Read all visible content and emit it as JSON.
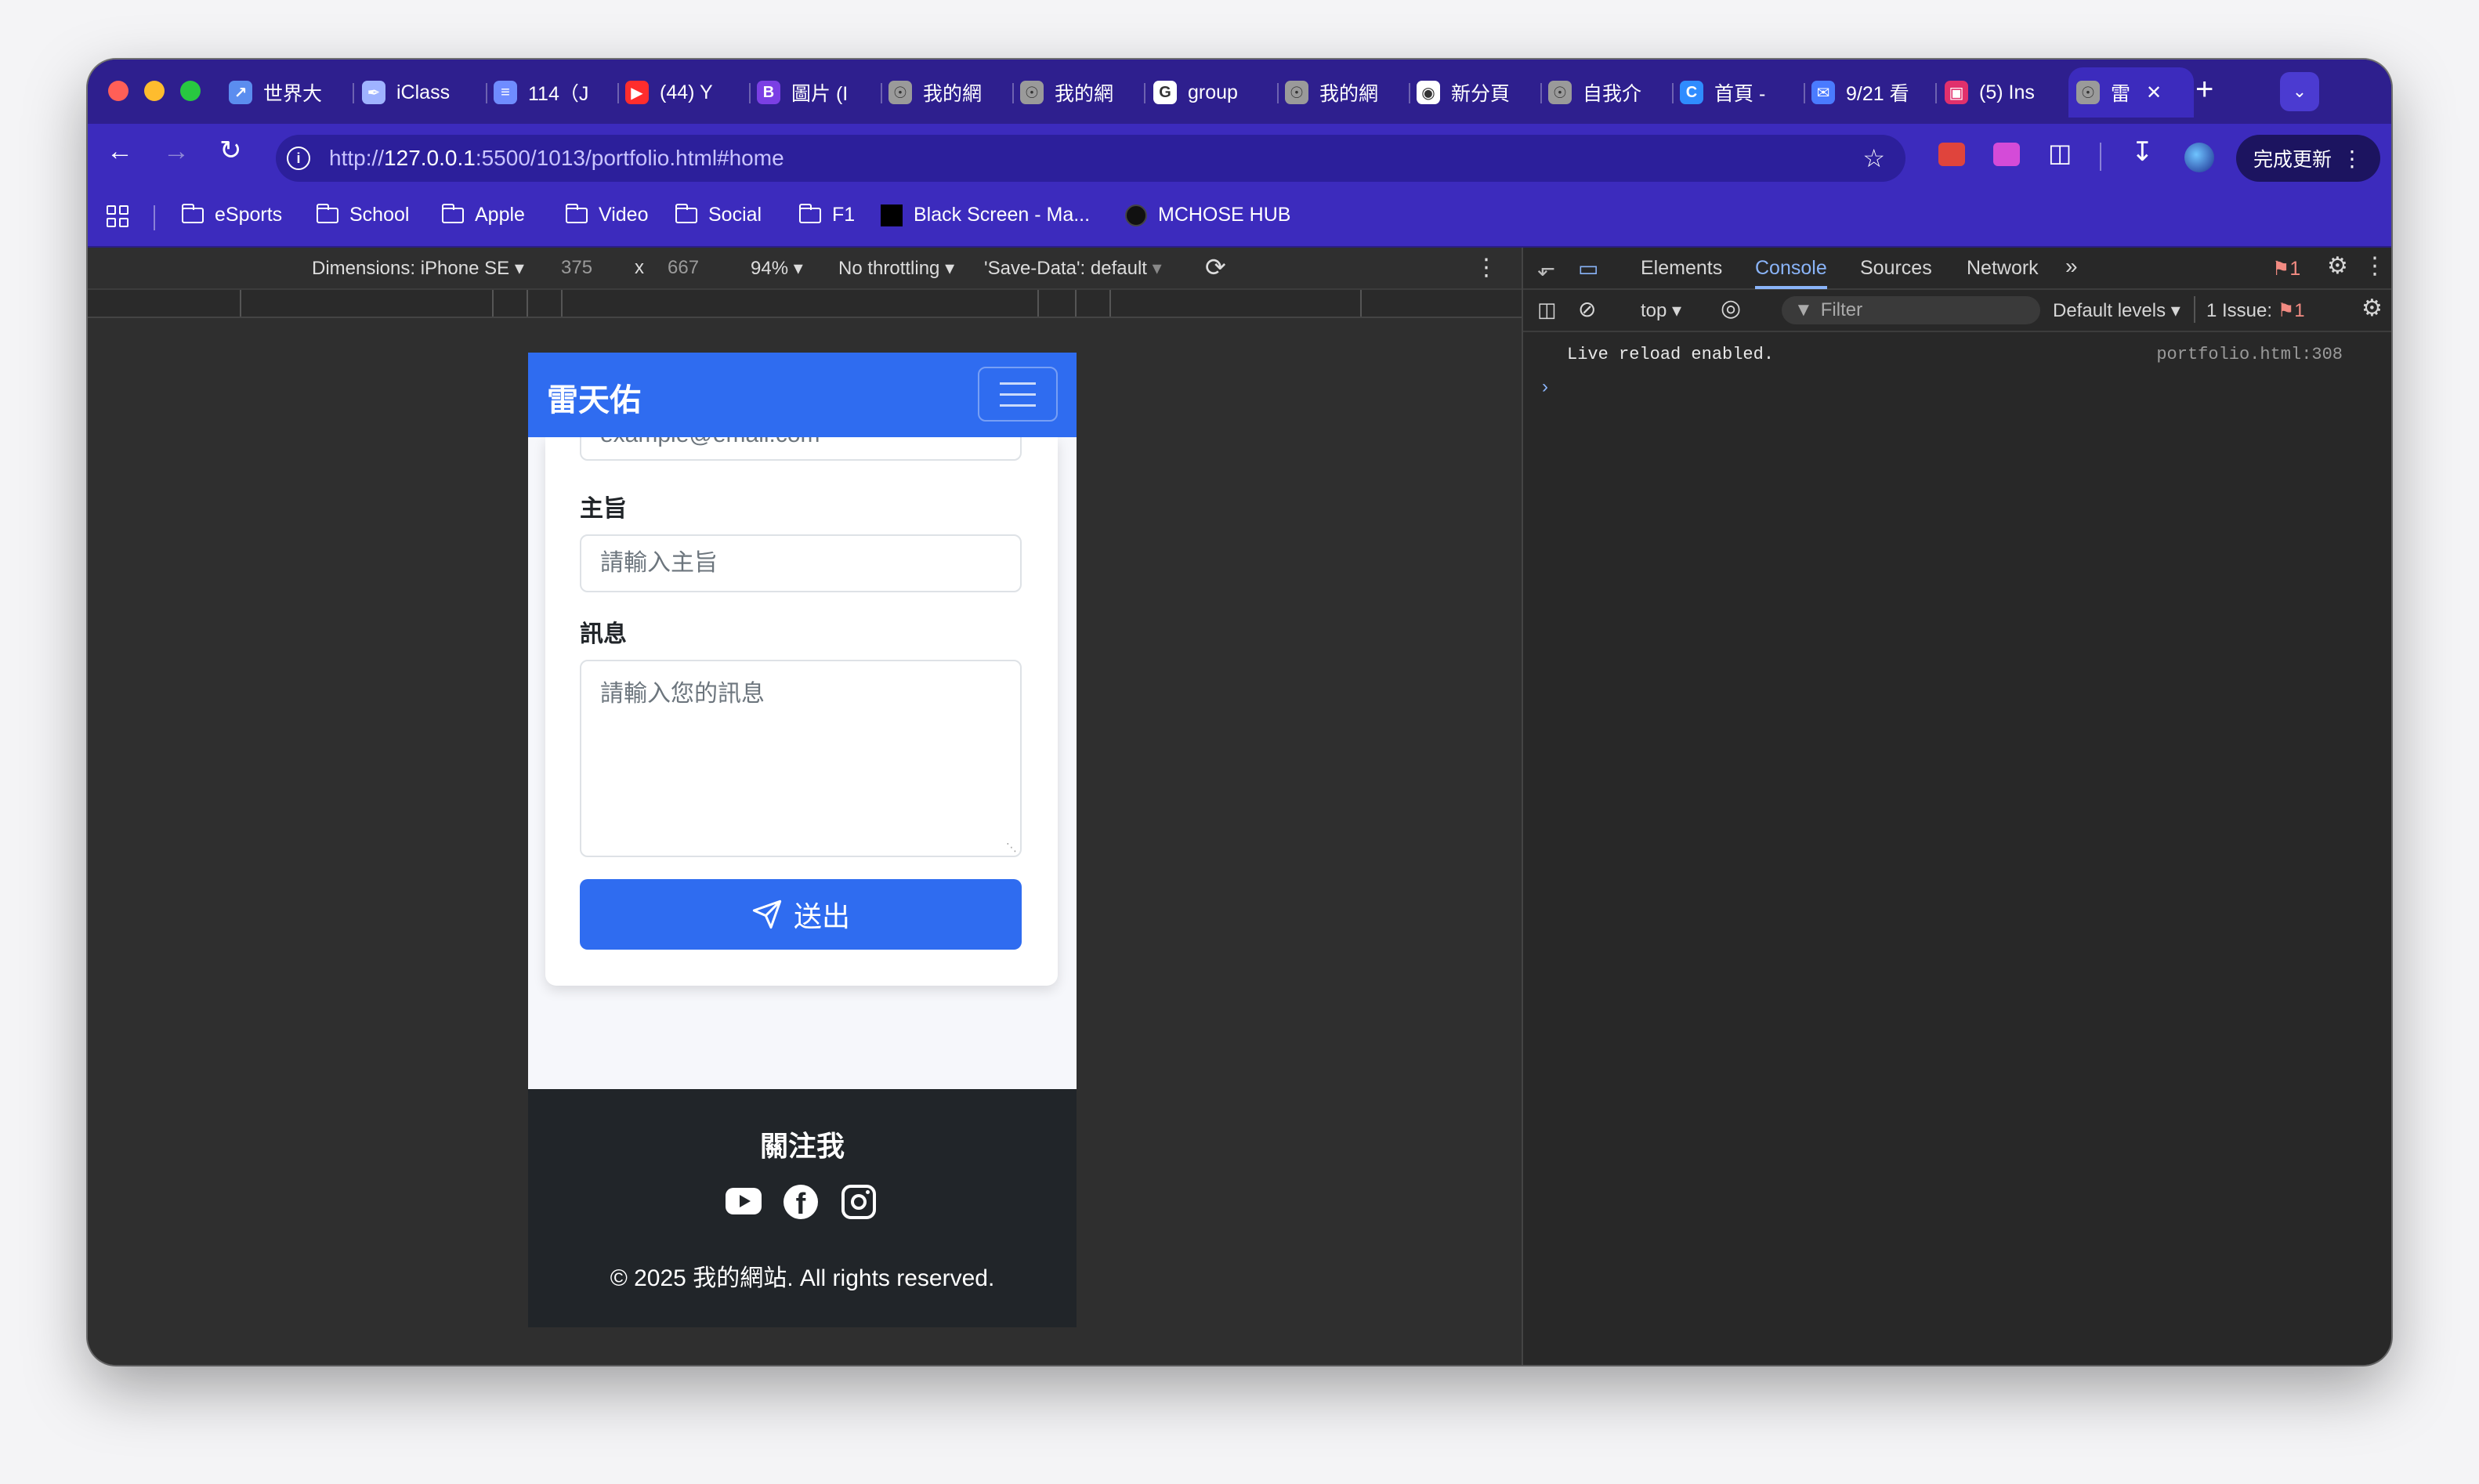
{
  "browser": {
    "tabs": [
      {
        "label": "世界大",
        "icon": "link-icon",
        "color": "#5b8def"
      },
      {
        "label": "iClass",
        "icon": "feather-icon",
        "color": "#9fb3ff"
      },
      {
        "label": "114（J",
        "icon": "layers-icon",
        "color": "#6f8cff"
      },
      {
        "label": "(44) Y",
        "icon": "youtube-icon",
        "color": "#ff2d2d"
      },
      {
        "label": "圖片 (I",
        "icon": "b-icon",
        "color": "#7b3fe4"
      },
      {
        "label": "我的網",
        "icon": "globe-icon",
        "color": "#9a9a9a"
      },
      {
        "label": "我的網",
        "icon": "globe-icon",
        "color": "#9a9a9a"
      },
      {
        "label": "group",
        "icon": "google-icon",
        "color": "#ffffff"
      },
      {
        "label": "我的網",
        "icon": "globe-icon",
        "color": "#9a9a9a"
      },
      {
        "label": "新分頁",
        "icon": "chrome-icon",
        "color": "#ffffff"
      },
      {
        "label": "自我介",
        "icon": "globe-icon",
        "color": "#9a9a9a"
      },
      {
        "label": "首頁 -",
        "icon": "c-icon",
        "color": "#2f8cff"
      },
      {
        "label": "9/21 看",
        "icon": "chat-icon",
        "color": "#4a7bff"
      },
      {
        "label": "(5) Ins",
        "icon": "instagram-icon",
        "color": "#e1306c"
      },
      {
        "label": "雷",
        "icon": "globe-icon",
        "color": "#9a9a9a"
      }
    ],
    "url_prefix": "http://",
    "url_host": "127.0.0.1",
    "url_rest": ":5500/1013/portfolio.html#home",
    "update_label": "完成更新",
    "bookmarks": [
      {
        "label": "eSports",
        "icon": "folder-icon"
      },
      {
        "label": "School",
        "icon": "folder-icon"
      },
      {
        "label": "Apple",
        "icon": "folder-icon"
      },
      {
        "label": "Video",
        "icon": "folder-icon"
      },
      {
        "label": "Social",
        "icon": "folder-icon"
      },
      {
        "label": "F1",
        "icon": "folder-icon"
      },
      {
        "label": "Black Screen - Ma...",
        "icon": "black-square-icon"
      },
      {
        "label": "MCHOSE HUB",
        "icon": "mchose-icon"
      }
    ]
  },
  "device_toolbar": {
    "dimensions": "Dimensions: iPhone SE",
    "width": "375",
    "times": "x",
    "height": "667",
    "zoom": "94%",
    "throttling": "No throttling",
    "save_data": "'Save-Data': default"
  },
  "site": {
    "brand": "雷天佑",
    "email_placeholder": "example@email.com",
    "subject_label": "主旨",
    "subject_placeholder": "請輸入主旨",
    "message_label": "訊息",
    "message_placeholder": "請輸入您的訊息",
    "submit_label": "送出",
    "footer_title": "關注我",
    "copyright": "© 2025 我的網站. All rights reserved.",
    "accent": "#2f6cf0"
  },
  "devtools": {
    "tabs": [
      "Elements",
      "Console",
      "Sources",
      "Network"
    ],
    "active_tab": "Console",
    "error_count": "1",
    "context": "top",
    "filter_placeholder": "Filter",
    "levels": "Default levels",
    "issues_label": "1 Issue:",
    "issues_count": "1",
    "log_message": "Live reload enabled.",
    "log_source": "portfolio.html:308"
  }
}
